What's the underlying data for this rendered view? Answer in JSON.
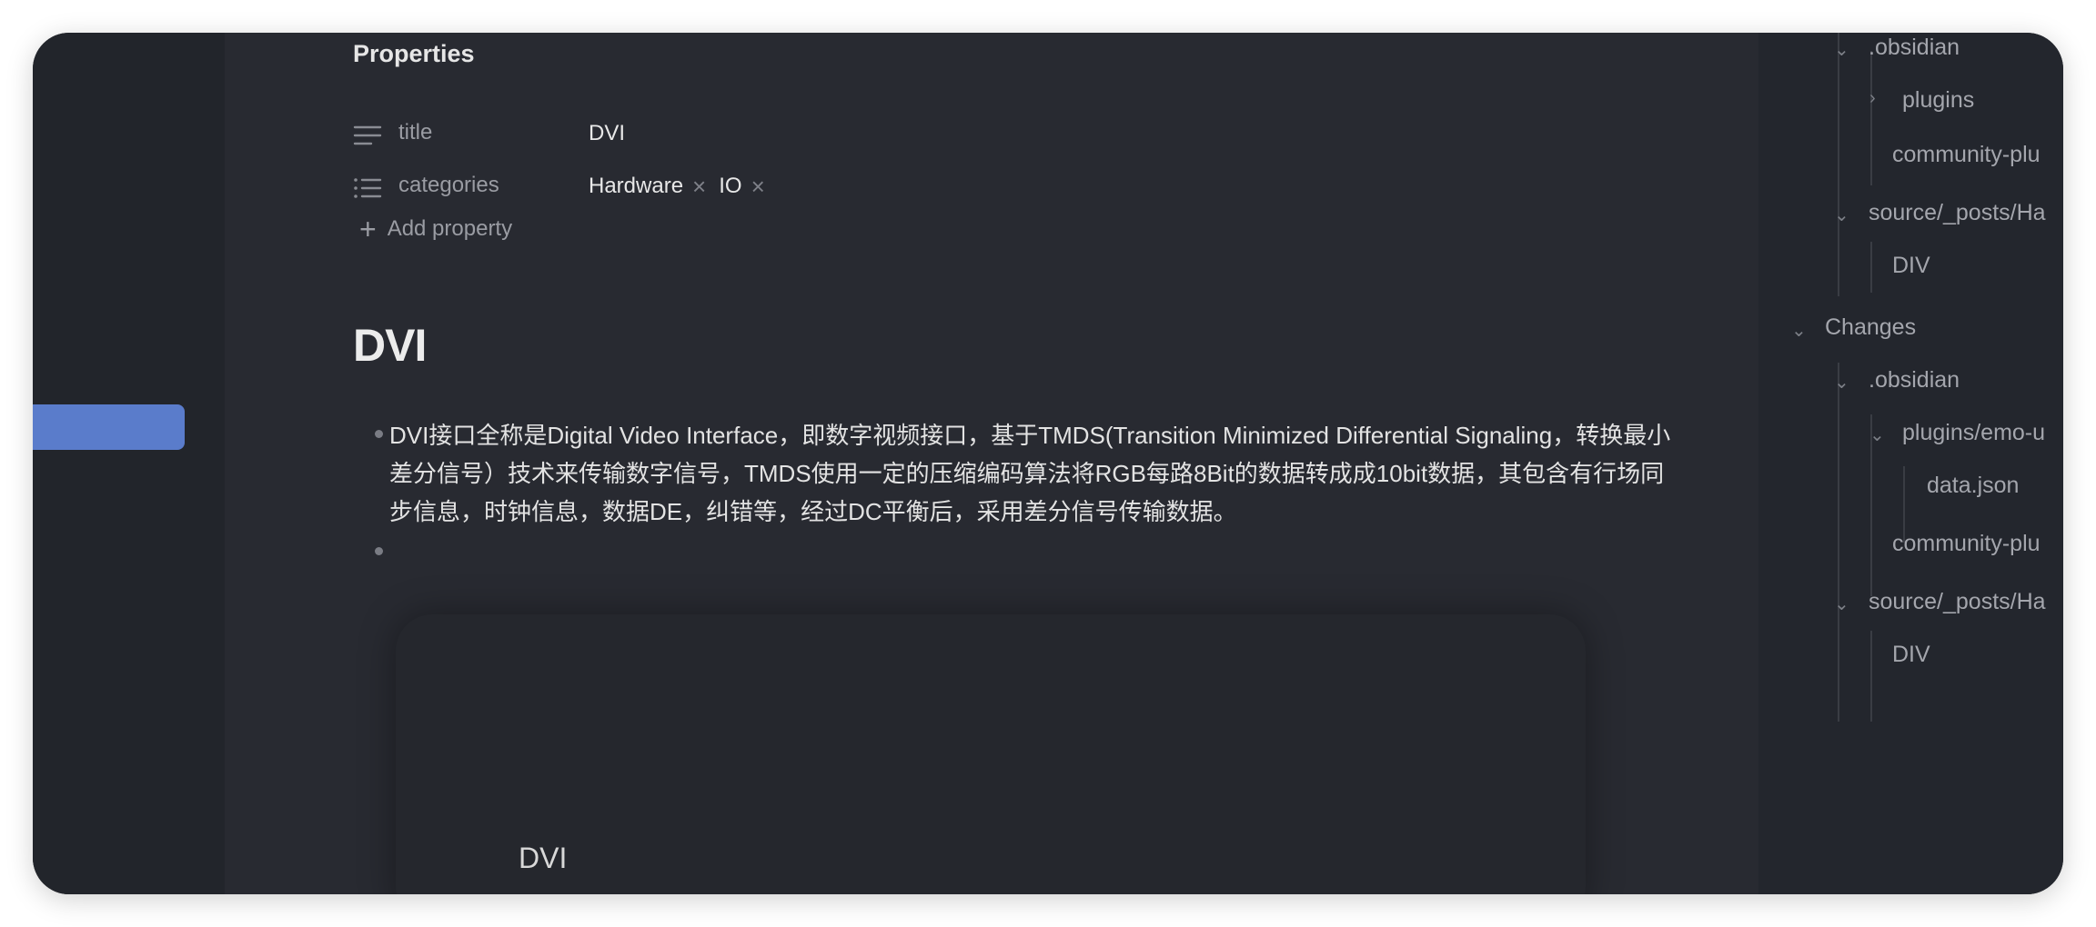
{
  "properties": {
    "heading": "Properties",
    "rows": [
      {
        "icon": "text-lines-icon",
        "key": "title",
        "value": "DVI"
      },
      {
        "icon": "list-icon",
        "key": "categories",
        "values": [
          "Hardware",
          "IO"
        ]
      }
    ],
    "add_label": "Add property"
  },
  "document": {
    "title": "DVI",
    "bullet_text": "DVI接口全称是Digital Video Interface，即数字视频接口，基于TMDS(Transition Minimized Differential Signaling，转换最小差分信号）技术来传输数字信号，TMDS使用一定的压缩编码算法将RGB每路8Bit的数据转成成10bit数据，其包含有行场同步信息，时钟信息，数据DE，纠错等，经过DC平衡后，采用差分信号传输数据。",
    "embed_title": "DVI"
  },
  "tree": {
    "items": [
      {
        "label": ".obsidian",
        "state": "expanded"
      },
      {
        "label": "plugins",
        "state": "collapsed"
      },
      {
        "label": "community-plu",
        "state": "leaf"
      },
      {
        "label": "source/_posts/Ha",
        "state": "expanded"
      },
      {
        "label": "DIV",
        "state": "leaf"
      },
      {
        "label": "Changes",
        "state": "expanded"
      },
      {
        "label": ".obsidian",
        "state": "expanded"
      },
      {
        "label": "plugins/emo-u",
        "state": "expanded"
      },
      {
        "label": "data.json",
        "state": "leaf"
      },
      {
        "label": "community-plu",
        "state": "leaf"
      },
      {
        "label": "source/_posts/Ha",
        "state": "expanded"
      },
      {
        "label": "DIV",
        "state": "leaf"
      }
    ]
  },
  "colors": {
    "accent": "#5a7ccb",
    "editor_bg": "#282a31",
    "sidebar_bg": "#22252b",
    "panel_bg": "#23262d"
  }
}
